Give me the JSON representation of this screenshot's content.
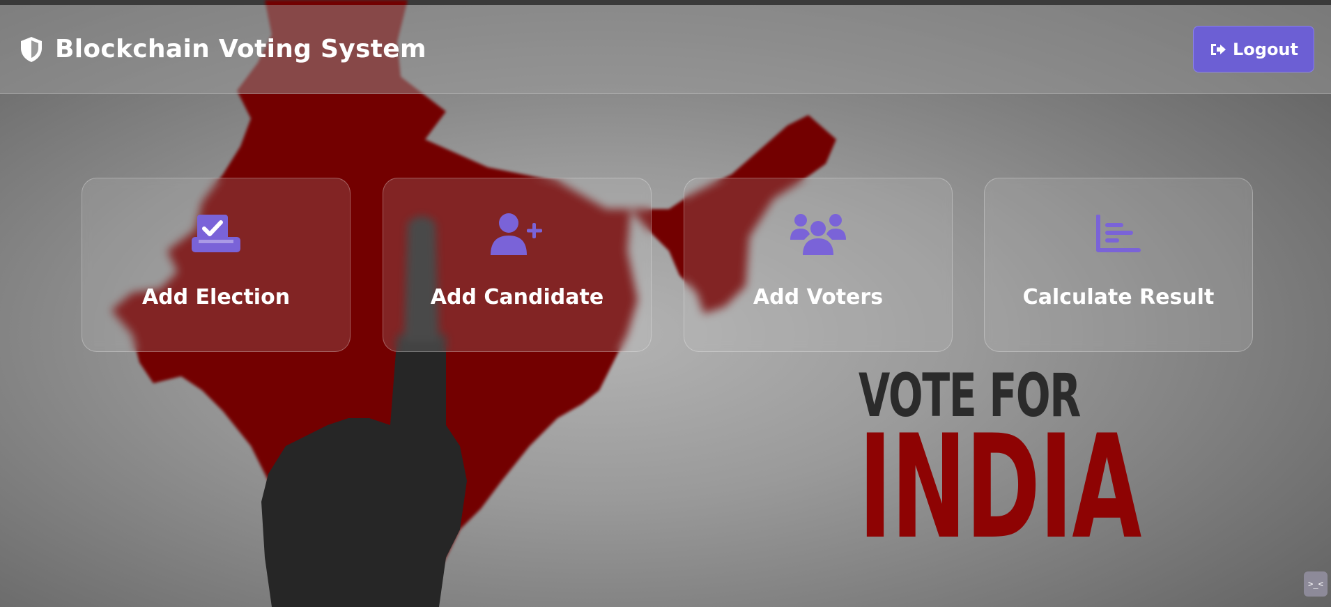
{
  "header": {
    "title": "Blockchain Voting System",
    "logo_icon": "shield-icon",
    "logout_label": "Logout",
    "logout_icon": "sign-out-icon"
  },
  "cards": [
    {
      "label": "Add Election",
      "icon": "vote-box-icon"
    },
    {
      "label": "Add Candidate",
      "icon": "user-plus-icon"
    },
    {
      "label": "Add Voters",
      "icon": "users-group-icon"
    },
    {
      "label": "Calculate Result",
      "icon": "bar-chart-icon"
    }
  ],
  "background": {
    "line1": "VOTE FOR",
    "line2": "INDIA"
  },
  "corner_widget": {
    "glyph": ">_<",
    "icon": "console-icon"
  },
  "colors": {
    "accent": "#6c5fd4",
    "map_red": "#7a0a0a",
    "india_text": "#8e0303"
  }
}
